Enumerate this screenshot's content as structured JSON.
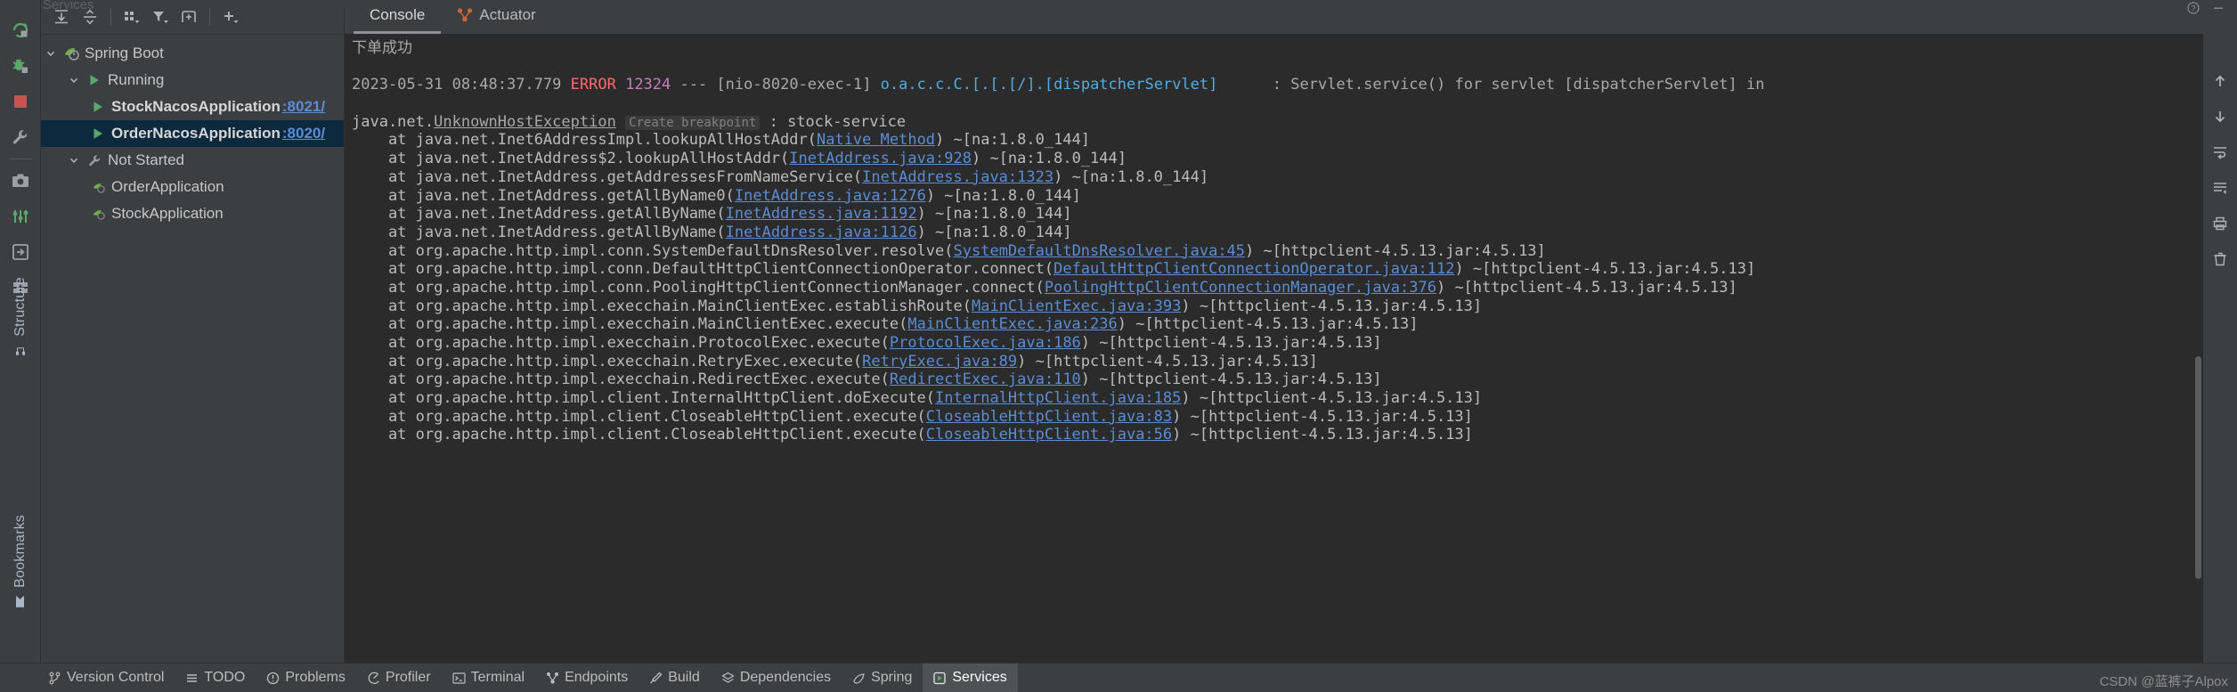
{
  "window": {
    "ghost_title": "Services"
  },
  "rail": {
    "icons": [
      {
        "name": "rerun-icon",
        "glyph": "rerun"
      },
      {
        "name": "debug-icon",
        "glyph": "debug"
      },
      {
        "name": "stop-icon",
        "glyph": "stop"
      },
      {
        "name": "settings-wrench-icon",
        "glyph": "wrench"
      },
      {
        "name": "camera-screenshot-icon",
        "glyph": "camera"
      },
      {
        "name": "thread-dump-icon",
        "glyph": "threads"
      },
      {
        "name": "export-icon",
        "glyph": "export"
      },
      {
        "name": "layout-icon",
        "glyph": "layout"
      }
    ],
    "vertical_labels": [
      "Structure",
      "Bookmarks"
    ]
  },
  "toolbar": {
    "buttons": [
      {
        "name": "expand-all-button",
        "glyph": "expand-all"
      },
      {
        "name": "collapse-all-button",
        "glyph": "collapse-all"
      },
      {
        "name": "group-by-button",
        "glyph": "group-by"
      },
      {
        "name": "filter-button",
        "glyph": "filter"
      },
      {
        "name": "add-tab-button",
        "glyph": "add-tab"
      },
      {
        "name": "add-service-button",
        "glyph": "plus"
      }
    ]
  },
  "services_tree": {
    "nodes": [
      {
        "label": "Spring Boot",
        "icon": "spring-boot-icon",
        "indent": 0,
        "expanded": true,
        "bold": false,
        "selected": false,
        "port": ""
      },
      {
        "label": "Running",
        "icon": "run-green-icon",
        "indent": 1,
        "expanded": true,
        "bold": false,
        "selected": false,
        "port": ""
      },
      {
        "label": "StockNacosApplication",
        "icon": "run-green-icon",
        "indent": 2,
        "expanded": false,
        "bold": true,
        "selected": false,
        "port": ":8021/"
      },
      {
        "label": "OrderNacosApplication",
        "icon": "run-green-icon",
        "indent": 2,
        "expanded": false,
        "bold": true,
        "selected": true,
        "port": ":8020/"
      },
      {
        "label": "Not Started",
        "icon": "wrench-icon",
        "indent": 1,
        "expanded": true,
        "bold": false,
        "selected": false,
        "port": ""
      },
      {
        "label": "OrderApplication",
        "icon": "config-icon",
        "indent": 2,
        "expanded": false,
        "bold": false,
        "selected": false,
        "port": ""
      },
      {
        "label": "StockApplication",
        "icon": "config-icon",
        "indent": 2,
        "expanded": false,
        "bold": false,
        "selected": false,
        "port": ""
      }
    ]
  },
  "console_tabs": [
    {
      "label": "Console",
      "icon": "console-icon",
      "active": true
    },
    {
      "label": "Actuator",
      "icon": "actuator-icon",
      "active": false
    }
  ],
  "console": {
    "lines": [
      {
        "type": "zh",
        "text": "下单成功"
      },
      {
        "type": "blank"
      },
      {
        "type": "log",
        "ts": "2023-05-31 08:48:37.779",
        "level": "ERROR",
        "pid": "12324",
        "sep": "---",
        "thread": "[nio-8020-exec-1]",
        "logger": "o.a.c.c.C.[.[.[/].[dispatcherServlet]",
        "colon": ":",
        "message": "Servlet.service() for servlet [dispatcherServlet] in"
      },
      {
        "type": "blank"
      },
      {
        "type": "exception",
        "pkg": "java.net.",
        "cls": "UnknownHostException",
        "breakpoint": "Create breakpoint",
        "colon": " : ",
        "msg": "stock-service"
      },
      {
        "type": "frame",
        "pre": "    at java.net.Inet6AddressImpl.lookupAllHostAddr(",
        "link": "Native Method",
        "post": ") ~[na:1.8.0_144]"
      },
      {
        "type": "frame",
        "pre": "    at java.net.InetAddress$2.lookupAllHostAddr(",
        "link": "InetAddress.java:928",
        "post": ") ~[na:1.8.0_144]"
      },
      {
        "type": "frame",
        "pre": "    at java.net.InetAddress.getAddressesFromNameService(",
        "link": "InetAddress.java:1323",
        "post": ") ~[na:1.8.0_144]"
      },
      {
        "type": "frame",
        "pre": "    at java.net.InetAddress.getAllByName0(",
        "link": "InetAddress.java:1276",
        "post": ") ~[na:1.8.0_144]"
      },
      {
        "type": "frame",
        "pre": "    at java.net.InetAddress.getAllByName(",
        "link": "InetAddress.java:1192",
        "post": ") ~[na:1.8.0_144]"
      },
      {
        "type": "frame",
        "pre": "    at java.net.InetAddress.getAllByName(",
        "link": "InetAddress.java:1126",
        "post": ") ~[na:1.8.0_144]"
      },
      {
        "type": "frame",
        "pre": "    at org.apache.http.impl.conn.SystemDefaultDnsResolver.resolve(",
        "link": "SystemDefaultDnsResolver.java:45",
        "post": ") ~[httpclient-4.5.13.jar:4.5.13]"
      },
      {
        "type": "frame",
        "pre": "    at org.apache.http.impl.conn.DefaultHttpClientConnectionOperator.connect(",
        "link": "DefaultHttpClientConnectionOperator.java:112",
        "post": ") ~[httpclient-4.5.13.jar:4.5.13]"
      },
      {
        "type": "frame",
        "pre": "    at org.apache.http.impl.conn.PoolingHttpClientConnectionManager.connect(",
        "link": "PoolingHttpClientConnectionManager.java:376",
        "post": ") ~[httpclient-4.5.13.jar:4.5.13]"
      },
      {
        "type": "frame",
        "pre": "    at org.apache.http.impl.execchain.MainClientExec.establishRoute(",
        "link": "MainClientExec.java:393",
        "post": ") ~[httpclient-4.5.13.jar:4.5.13]"
      },
      {
        "type": "frame",
        "pre": "    at org.apache.http.impl.execchain.MainClientExec.execute(",
        "link": "MainClientExec.java:236",
        "post": ") ~[httpclient-4.5.13.jar:4.5.13]"
      },
      {
        "type": "frame",
        "pre": "    at org.apache.http.impl.execchain.ProtocolExec.execute(",
        "link": "ProtocolExec.java:186",
        "post": ") ~[httpclient-4.5.13.jar:4.5.13]"
      },
      {
        "type": "frame",
        "pre": "    at org.apache.http.impl.execchain.RetryExec.execute(",
        "link": "RetryExec.java:89",
        "post": ") ~[httpclient-4.5.13.jar:4.5.13]"
      },
      {
        "type": "frame",
        "pre": "    at org.apache.http.impl.execchain.RedirectExec.execute(",
        "link": "RedirectExec.java:110",
        "post": ") ~[httpclient-4.5.13.jar:4.5.13]"
      },
      {
        "type": "frame",
        "pre": "    at org.apache.http.impl.client.InternalHttpClient.doExecute(",
        "link": "InternalHttpClient.java:185",
        "post": ") ~[httpclient-4.5.13.jar:4.5.13]"
      },
      {
        "type": "frame",
        "pre": "    at org.apache.http.impl.client.CloseableHttpClient.execute(",
        "link": "CloseableHttpClient.java:83",
        "post": ") ~[httpclient-4.5.13.jar:4.5.13]"
      },
      {
        "type": "frame",
        "pre": "    at org.apache.http.impl.client.CloseableHttpClient.execute(",
        "link": "CloseableHttpClient.java:56",
        "post": ") ~[httpclient-4.5.13.jar:4.5.13]"
      }
    ]
  },
  "console_gutter": [
    {
      "name": "scroll-up-icon"
    },
    {
      "name": "scroll-down-icon"
    },
    {
      "name": "soft-wrap-icon"
    },
    {
      "name": "scroll-to-end-icon"
    },
    {
      "name": "print-icon"
    },
    {
      "name": "clear-all-icon"
    }
  ],
  "status_bar": {
    "items": [
      {
        "label": "Version Control",
        "icon": "branch-icon",
        "active": false
      },
      {
        "label": "TODO",
        "icon": "list-icon",
        "active": false
      },
      {
        "label": "Problems",
        "icon": "warning-icon",
        "active": false
      },
      {
        "label": "Profiler",
        "icon": "profiler-icon",
        "active": false
      },
      {
        "label": "Terminal",
        "icon": "terminal-icon",
        "active": false
      },
      {
        "label": "Endpoints",
        "icon": "endpoints-icon",
        "active": false
      },
      {
        "label": "Build",
        "icon": "build-hammer-icon",
        "active": false
      },
      {
        "label": "Dependencies",
        "icon": "dependencies-icon",
        "active": false
      },
      {
        "label": "Spring",
        "icon": "spring-leaf-icon",
        "active": false
      },
      {
        "label": "Services",
        "icon": "services-icon",
        "active": true
      }
    ],
    "watermark": "CSDN @蓝裤子Alpox"
  },
  "colors": {
    "panel_bg": "#3c3f41",
    "console_bg": "#2b2b2b",
    "selection": "#0d293e",
    "error_red": "#ff6b68",
    "link_blue": "#5a8dd6",
    "logger_cyan": "#4eade5",
    "pid_magenta": "#c77dbb",
    "run_green": "#59a869",
    "stop_red": "#c75450",
    "actuator_orange": "#cc6633"
  }
}
